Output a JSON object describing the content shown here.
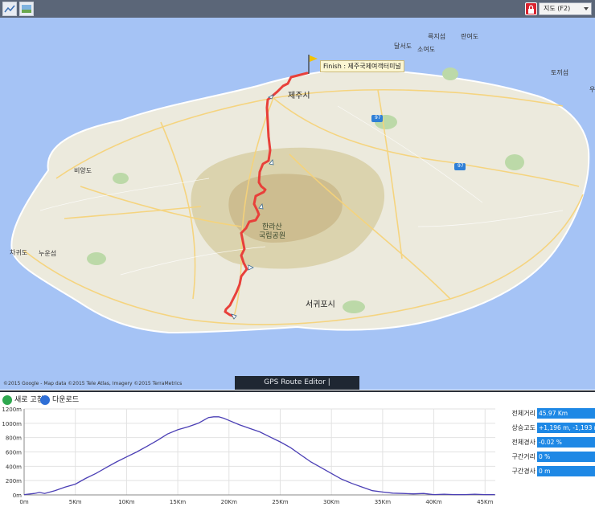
{
  "toolbar": {
    "left_buttons": [
      "chart-icon",
      "map-image-icon"
    ],
    "map_type_select": "지도 (F2)"
  },
  "map": {
    "labels": {
      "dalseodo": "달서도",
      "sugeunjiseom": "륵지섬",
      "ranyeodo": "란여도",
      "soyeodo": "소여도",
      "tokkiseom": "토끼섬",
      "u": "우",
      "jejusi": "제주시",
      "biyangdo": "비양도",
      "chagwido": "차귀도",
      "nunseom": "누운섬",
      "hallasan_1": "한라산",
      "hallasan_2": "국립공원",
      "seogwiposi": "서귀포시",
      "route_97a": "97",
      "route_97b": "97"
    },
    "finish_label": "Finish : 제주국제여객터미널",
    "copyright": "©2015 Google - Map data ©2015 Tele Atlas, Imagery ©2015 TerraMetrics",
    "banner": "GPS Route Editor | www.gpsnote.net",
    "colors": {
      "sea": "#a5c3f5",
      "land": "#eceadd",
      "route": "#e8403a",
      "park": "#d8cfa6"
    }
  },
  "bottom_toolbar": {
    "refresh_label": "새로 고침",
    "download_label": "다운로드"
  },
  "stats": [
    {
      "label": "전체거리",
      "value": "45.97 Km"
    },
    {
      "label": "상승고도",
      "value": "+1,196 m, -1,193 m"
    },
    {
      "label": "전체경사",
      "value": "-0.02 %"
    },
    {
      "label": "구간거리",
      "value": "0 %"
    },
    {
      "label": "구간경사",
      "value": "0 m"
    }
  ],
  "chart_data": {
    "type": "line",
    "xlabel": "",
    "ylabel": "",
    "x_ticks": [
      "0m",
      "5Km",
      "10Km",
      "15Km",
      "20Km",
      "25Km",
      "30Km",
      "35Km",
      "40Km",
      "45Km"
    ],
    "y_ticks": [
      "0m",
      "200m",
      "400m",
      "600m",
      "800m",
      "1000m",
      "1200m"
    ],
    "xlim": [
      0,
      46
    ],
    "ylim": [
      0,
      1200
    ],
    "grid": true,
    "color": "#4b3fb5",
    "series": [
      {
        "x": [
          0,
          1,
          1.5,
          2,
          3,
          4,
          5,
          6,
          7,
          8,
          9,
          10,
          11,
          12,
          13,
          14,
          15,
          16,
          17,
          18,
          18.5,
          19,
          19.5,
          20,
          21,
          22,
          23,
          24,
          25,
          26,
          27,
          28,
          29,
          30,
          31,
          32,
          33,
          34,
          35,
          36,
          37,
          38,
          39,
          40,
          41,
          42,
          43,
          44,
          45,
          45.97
        ],
        "y": [
          5,
          20,
          35,
          20,
          60,
          110,
          150,
          230,
          300,
          380,
          460,
          530,
          600,
          680,
          760,
          850,
          910,
          950,
          1000,
          1080,
          1090,
          1090,
          1070,
          1040,
          980,
          930,
          880,
          810,
          740,
          660,
          560,
          460,
          380,
          300,
          220,
          160,
          110,
          60,
          40,
          25,
          20,
          15,
          20,
          5,
          10,
          5,
          5,
          10,
          5,
          5
        ]
      }
    ]
  }
}
